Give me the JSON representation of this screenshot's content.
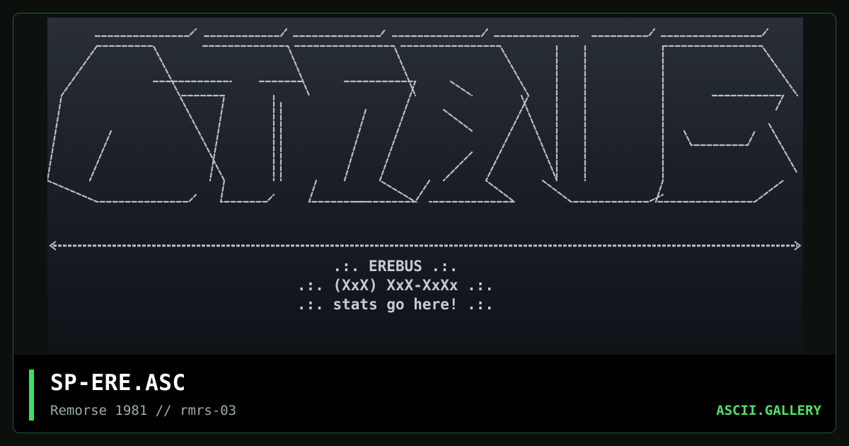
{
  "card": {
    "title": "SP-ERE.ASC",
    "subtitle": "Remorse 1981 // rmrs-03",
    "brand": "ASCII.GALLERY"
  },
  "art": {
    "info_lines": [
      ".:. EREBUS .:.",
      ".:. (XxX) XxX-XxXx .:.",
      ".:. stats go here! .:."
    ]
  },
  "colors": {
    "accent": "#3be05e",
    "brand": "#4fe06a",
    "subtitle": "#9db09f",
    "art_ink": "#c8ccd2"
  }
}
